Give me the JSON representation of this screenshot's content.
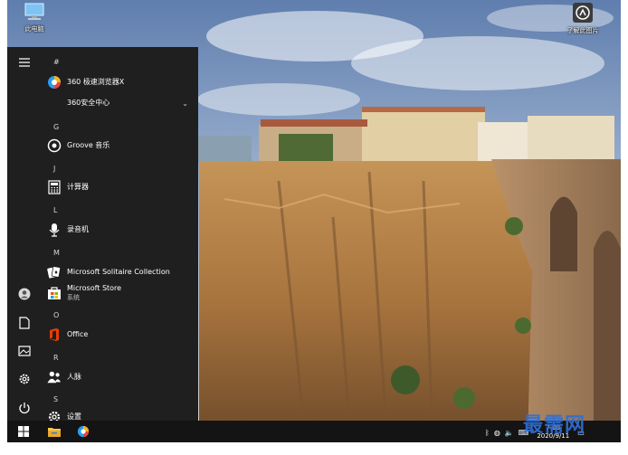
{
  "desktop": {
    "icons": [
      {
        "name": "此电脑",
        "icon": "this-pc-icon"
      },
      {
        "name": "了解此图片",
        "icon": "learn-about-picture-icon"
      }
    ]
  },
  "start_menu": {
    "rail": [
      "hamburger-menu-icon",
      "user-account-icon",
      "documents-icon",
      "pictures-icon",
      "settings-icon",
      "power-icon"
    ],
    "sections": [
      {
        "header": "#",
        "apps": [
          {
            "label": "360 极速浏览器X",
            "icon": "360-browser-icon"
          },
          {
            "label": "360安全中心",
            "icon": "",
            "expandable": true
          }
        ]
      },
      {
        "header": "G",
        "apps": [
          {
            "label": "Groove 音乐",
            "icon": "groove-music-icon"
          }
        ]
      },
      {
        "header": "J",
        "apps": [
          {
            "label": "计算器",
            "icon": "calculator-icon"
          }
        ]
      },
      {
        "header": "L",
        "apps": [
          {
            "label": "录音机",
            "icon": "voice-recorder-icon"
          }
        ]
      },
      {
        "header": "M",
        "apps": [
          {
            "label": "Microsoft Solitaire Collection",
            "icon": "solitaire-icon"
          },
          {
            "label": "Microsoft Store",
            "sub": "系统",
            "icon": "store-icon"
          }
        ]
      },
      {
        "header": "O",
        "apps": [
          {
            "label": "Office",
            "icon": "office-icon"
          }
        ]
      },
      {
        "header": "R",
        "apps": [
          {
            "label": "人脉",
            "icon": "people-icon"
          }
        ]
      },
      {
        "header": "S",
        "apps": [
          {
            "label": "设置",
            "icon": "settings-app-icon"
          }
        ]
      }
    ]
  },
  "taskbar": {
    "items": [
      "start-button",
      "file-explorer-icon",
      "360-browser-icon"
    ],
    "clock": {
      "time": "7:08",
      "date": "2020/9/11"
    }
  },
  "watermark": "最需网",
  "colors": {
    "start_bg": "#1f1f1f",
    "taskbar_bg": "#141414",
    "accent": "#2d6fd8"
  }
}
